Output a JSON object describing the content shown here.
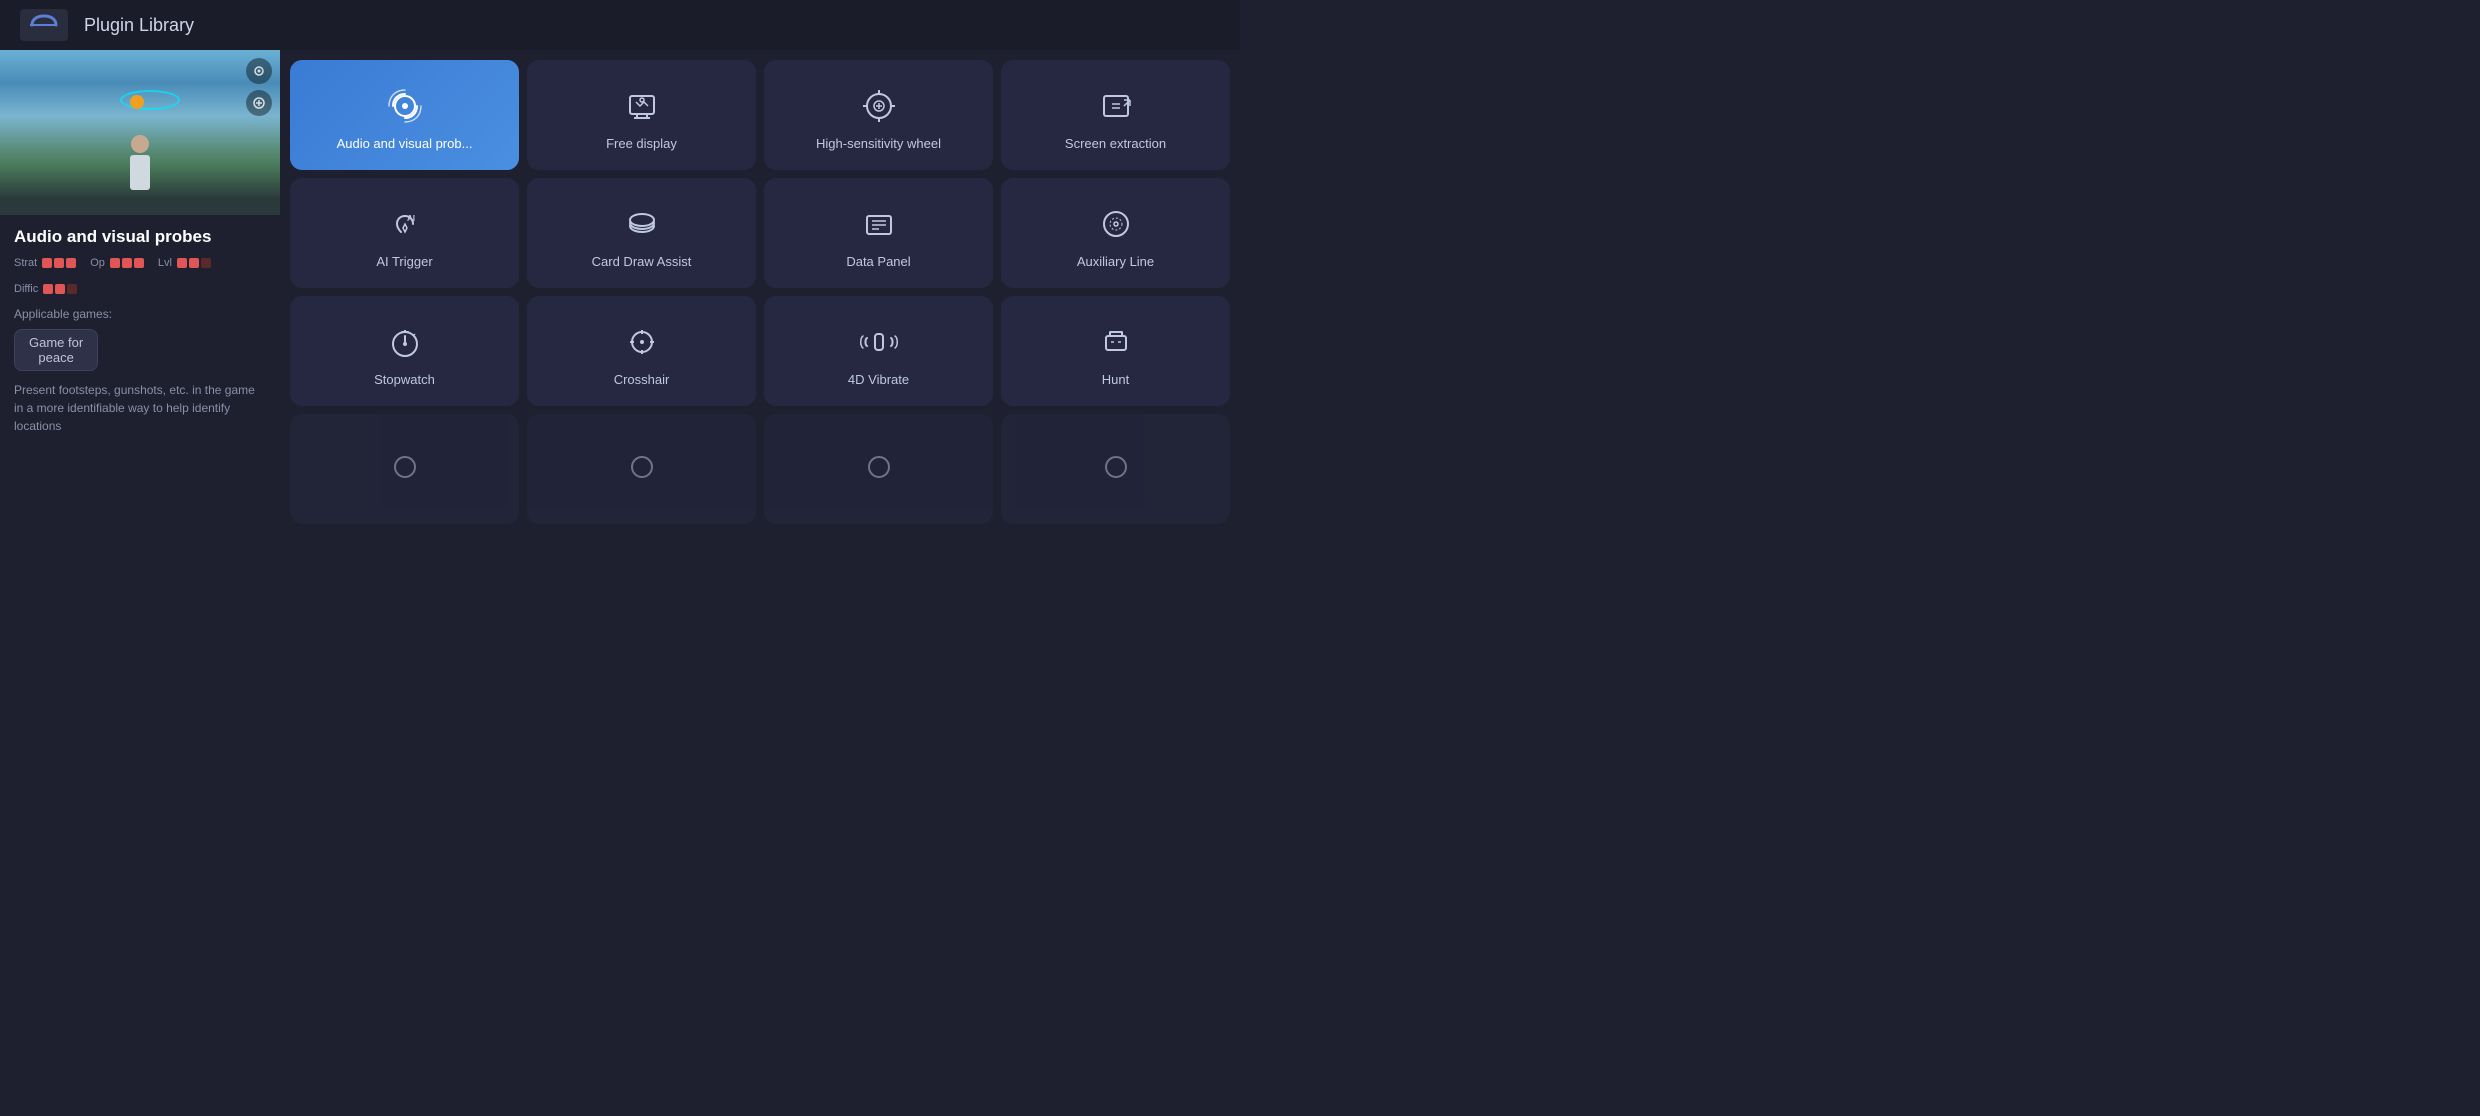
{
  "header": {
    "title": "Plugin Library",
    "logo_alt": "logo"
  },
  "left_panel": {
    "plugin_title": "Audio and visual probes",
    "ratings": [
      {
        "label": "Strat",
        "filled": 3,
        "empty": 0
      },
      {
        "label": "Op",
        "filled": 3,
        "empty": 0
      },
      {
        "label": "Lvl",
        "filled": 2,
        "empty": 1
      },
      {
        "label": "Diffic",
        "filled": 2,
        "empty": 1
      }
    ],
    "applicable_label": "Applicable games:",
    "game_tag": "Game for\npeace",
    "description": "Present footsteps, gunshots, etc. in the game in a more identifiable way to help identify locations"
  },
  "plugins": [
    {
      "id": "audio-visual",
      "name": "Audio and visual probes",
      "active": true,
      "icon": "audio-visual-icon"
    },
    {
      "id": "free-display",
      "name": "Free display",
      "active": false,
      "icon": "free-display-icon"
    },
    {
      "id": "high-sensitivity",
      "name": "High-sensitivity wheel",
      "active": false,
      "icon": "high-sensitivity-icon"
    },
    {
      "id": "screen-extraction",
      "name": "Screen extraction",
      "active": false,
      "icon": "screen-extraction-icon"
    },
    {
      "id": "ai-trigger",
      "name": "AI Trigger",
      "active": false,
      "icon": "ai-trigger-icon"
    },
    {
      "id": "card-draw",
      "name": "Card Draw Assist",
      "active": false,
      "icon": "card-draw-icon"
    },
    {
      "id": "data-panel",
      "name": "Data Panel",
      "active": false,
      "icon": "data-panel-icon"
    },
    {
      "id": "auxiliary-line",
      "name": "Auxiliary Line",
      "active": false,
      "icon": "auxiliary-line-icon"
    },
    {
      "id": "stopwatch",
      "name": "Stopwatch",
      "active": false,
      "icon": "stopwatch-icon"
    },
    {
      "id": "crosshair",
      "name": "Crosshair",
      "active": false,
      "icon": "crosshair-icon"
    },
    {
      "id": "4d-vibrate",
      "name": "4D Vibrate",
      "active": false,
      "icon": "vibrate-icon"
    },
    {
      "id": "hunt",
      "name": "Hunt",
      "active": false,
      "icon": "hunt-icon"
    },
    {
      "id": "more1",
      "name": "",
      "active": false,
      "icon": ""
    },
    {
      "id": "more2",
      "name": "",
      "active": false,
      "icon": ""
    },
    {
      "id": "more3",
      "name": "",
      "active": false,
      "icon": ""
    },
    {
      "id": "more4",
      "name": "",
      "active": false,
      "icon": ""
    }
  ]
}
